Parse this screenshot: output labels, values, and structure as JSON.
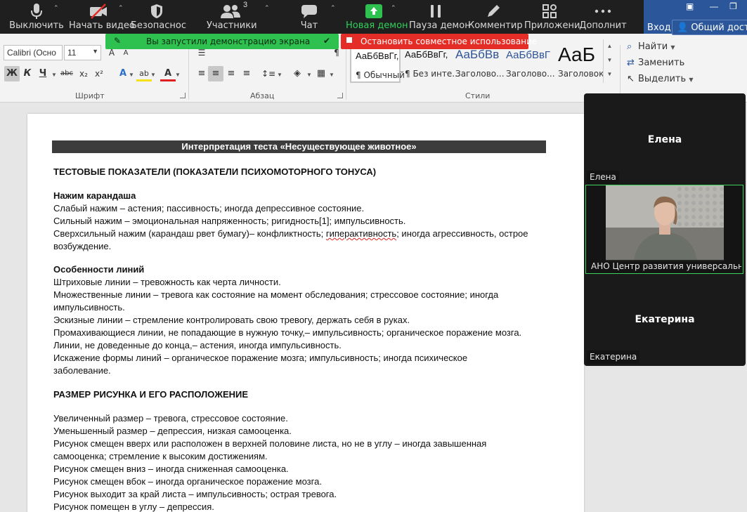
{
  "zoom_toolbar": {
    "mute_label": "Выключить",
    "video_label": "Начать видео",
    "security_label": "Безопаснос",
    "participants_label": "Участники",
    "participants_count": "3",
    "chat_label": "Чат",
    "new_share_label": "Новая демон",
    "pause_share_label": "Пауза демон",
    "annotate_label": "Комментир",
    "apps_label": "Приложени",
    "more_label": "Дополнит",
    "accent_green": "#2fd05a"
  },
  "share_banner": {
    "sharing_text": "Вы запустили демонстрацию экрана",
    "stop_text": "Остановить совместное использование"
  },
  "word_header": {
    "sign_in": "Вход",
    "share": "Общий доступ"
  },
  "ribbon": {
    "font_name": "Calibri (Осно",
    "font_size": "11",
    "bold": "Ж",
    "italic": "К",
    "underline": "Ч",
    "strike": "abc",
    "subscript": "x₂",
    "superscript": "x²",
    "font_group": "Шрифт",
    "paragraph_group": "Абзац",
    "styles_group": "Стили",
    "styles": [
      {
        "sample": "АаБбВвГг,",
        "name": "¶ Обычный"
      },
      {
        "sample": "АаБбВвГг,",
        "name": "¶ Без инте..."
      },
      {
        "sample": "АаБбВв",
        "name": "Заголово..."
      },
      {
        "sample": "АаБбВвГ",
        "name": "Заголово..."
      },
      {
        "sample": "АаБ",
        "name": "Заголовок"
      }
    ],
    "find": "Найти",
    "replace": "Заменить",
    "select": "Выделить"
  },
  "document": {
    "title": "Интерпретация теста «Несуществующее животное»",
    "lines": [
      {
        "text": "ТЕСТОВЫЕ ПОКАЗАТЕЛИ (ПОКАЗАТЕЛИ ПСИХОМОТОРНОГО ТОНУСА)",
        "bold": true
      },
      {
        "text": "Нажим карандаша",
        "bold": true
      },
      {
        "text": "Слабый нажим – астения; пассивность; иногда депрессивное состояние.",
        "bold": false
      },
      {
        "text": "Сильный нажим – эмоциональная напряженность; ригидность[1]; импульсивность.",
        "bold": false
      },
      {
        "text": "Сверхсильный нажим (карандаш рвет бумагу)– конфликтность; ",
        "bold": false,
        "squiggle": "гиперактивность",
        "rest": "; иногда агрессивность, острое"
      },
      {
        "text": "возбуждение.",
        "bold": false
      },
      {
        "text": "Особенности линий",
        "bold": true
      },
      {
        "text": "Штриховые линии – тревожность как черта личности.",
        "bold": false
      },
      {
        "text": "Множественные линии – тревога как состояние на момент обследования; стрессовое состояние; иногда",
        "bold": false
      },
      {
        "text": "импульсивность.",
        "bold": false
      },
      {
        "text": "Эскизные линии – стремление контролировать свою тревогу, держать себя в руках.",
        "bold": false
      },
      {
        "text": "Промахивающиеся линии, не попадающие в нужную точку,– импульсивность; органическое поражение мозга.",
        "bold": false
      },
      {
        "text": "Линии, не доведенные до конца,– астения, иногда импульсивность.",
        "bold": false
      },
      {
        "text": "Искажение формы линий – органическое поражение мозга; импульсивность; иногда психическое",
        "bold": false
      },
      {
        "text": "заболевание.",
        "bold": false
      },
      {
        "text": "РАЗМЕР РИСУНКА И ЕГО РАСПОЛОЖЕНИЕ",
        "bold": true
      },
      {
        "text": "Увеличенный размер – тревога, стрессовое состояние.",
        "bold": false
      },
      {
        "text": "Уменьшенный размер – депрессия, низкая самооценка.",
        "bold": false
      },
      {
        "text": "Рисунок смещен вверх или расположен в верхней половине листа, но не в углу – иногда завышенная",
        "bold": false
      },
      {
        "text": "самооценка; стремление к высоким достижениям.",
        "bold": false
      },
      {
        "text": "Рисунок смещен вниз – иногда сниженная самооценка.",
        "bold": false
      },
      {
        "text": "Рисунок смещен вбок – иногда органическое поражение мозга.",
        "bold": false
      },
      {
        "text": "Рисунок выходит за край листа – импульсивность; острая тревога.",
        "bold": false
      },
      {
        "text": "Рисунок помещен в углу – депрессия.",
        "bold": false
      }
    ]
  },
  "gallery": {
    "p1_center": "Елена",
    "p1_tag": "Елена",
    "p2_tag": "АНО Центр развития универсальн...",
    "p3_center": "Екатерина",
    "p3_tag": "Екатерина",
    "active_speaker_color": "#3bd15a"
  }
}
